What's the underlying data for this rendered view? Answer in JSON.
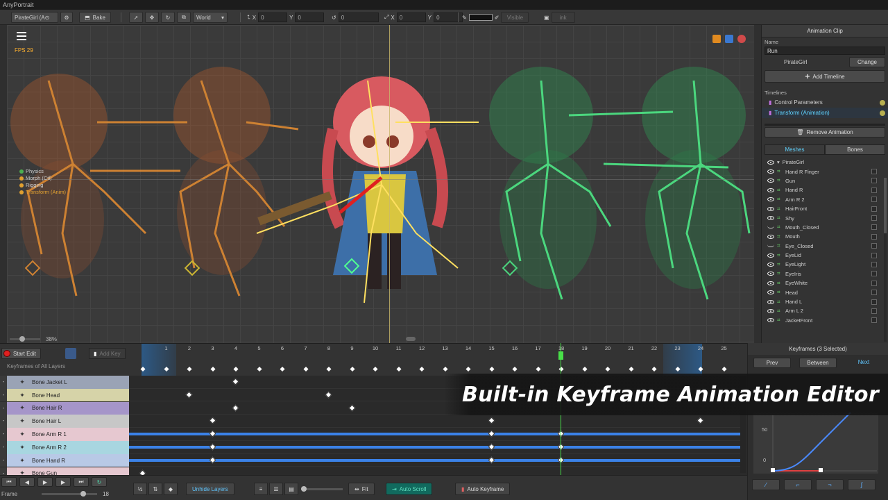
{
  "app": {
    "title": "AnyPortrait"
  },
  "toolbar": {
    "portrait_selector": "PirateGirl (A⊙",
    "bake_label": "Bake",
    "space_select": "World",
    "pos_x_label": "X",
    "pos_x": "0",
    "pos_y_label": "Y",
    "pos_y": "0",
    "rot_value": "0",
    "scale_x_label": "X",
    "scale_x": "0",
    "scale_y_label": "Y",
    "scale_y": "0",
    "visible_label": "Visible",
    "ink_label": "ink"
  },
  "viewport": {
    "fps": "FPS 29",
    "zoom": "38%",
    "timeline_legend": [
      {
        "label": "Physics",
        "color": "#4caf50"
      },
      {
        "label": "Morph (Ctl)",
        "color": "#e0a030"
      },
      {
        "label": "Rigging",
        "color": "#e0a030"
      },
      {
        "label": "Transform (Anim)",
        "color": "#e0a030"
      }
    ],
    "icons": [
      "bone-ik-icon",
      "mesh-icon",
      "physics-icon"
    ]
  },
  "right_panel": {
    "header": "Animation Clip",
    "name_label": "Name",
    "name_value": "Run",
    "target": "PirateGirl",
    "change_label": "Change",
    "add_timeline_label": "Add Timeline",
    "timelines_label": "Timelines",
    "timelines": [
      {
        "label": "Control Parameters",
        "color": "#cfcfcf"
      },
      {
        "label": "Transform (Animation)",
        "color": "#5fd3ff"
      }
    ],
    "remove_animation_label": "Remove Animation",
    "tabs": {
      "meshes": "Meshes",
      "bones": "Bones"
    },
    "tree_root": "PirateGirl",
    "tree_items": [
      {
        "label": "Hand R Finger",
        "eye": "open"
      },
      {
        "label": "Gun",
        "eye": "open"
      },
      {
        "label": "Hand R",
        "eye": "open"
      },
      {
        "label": "Arm R 2",
        "eye": "open"
      },
      {
        "label": "HairFront",
        "eye": "open"
      },
      {
        "label": "Shy",
        "eye": "open"
      },
      {
        "label": "Mouth_Closed",
        "eye": "closed"
      },
      {
        "label": "Mouth",
        "eye": "open"
      },
      {
        "label": "Eye_Closed",
        "eye": "closed"
      },
      {
        "label": "EyeLid",
        "eye": "open"
      },
      {
        "label": "EyeLight",
        "eye": "open"
      },
      {
        "label": "EyeIris",
        "eye": "open"
      },
      {
        "label": "EyeWhite",
        "eye": "open"
      },
      {
        "label": "Head",
        "eye": "open"
      },
      {
        "label": "Hand L",
        "eye": "open"
      },
      {
        "label": "Arm L 2",
        "eye": "open"
      },
      {
        "label": "JacketFront",
        "eye": "open"
      }
    ]
  },
  "timeline": {
    "start_edit_label": "Start Edit",
    "add_key_label": "Add Key",
    "keyframes_all_layers": "Keyframes of All Layers",
    "ruler_ticks": [
      "1",
      "2",
      "3",
      "4",
      "5",
      "6",
      "7",
      "8",
      "9",
      "10",
      "11",
      "12",
      "13",
      "14",
      "15",
      "16",
      "17",
      "18",
      "19",
      "20",
      "21",
      "22",
      "23",
      "24",
      "25"
    ],
    "current_frame": 18,
    "layers": [
      {
        "label": "Bone Jacket L",
        "color": "#9aa3b5"
      },
      {
        "label": "Bone Head",
        "color": "#d6d3a8"
      },
      {
        "label": "Bone Hair R",
        "color": "#a595c9"
      },
      {
        "label": "Bone Hair L",
        "color": "#c7c7c7"
      },
      {
        "label": "Bone Arm R 1",
        "color": "#e6c8d0"
      },
      {
        "label": "Bone Arm R 2",
        "color": "#a8d6e0"
      },
      {
        "label": "Bone Hand R",
        "color": "#b8c9e6"
      },
      {
        "label": "Bone Gun",
        "color": "#e6c8d0"
      }
    ]
  },
  "bottom_bar": {
    "frame_label": "Frame",
    "frame_value": "18",
    "unhide_layers_label": "Unhide Layers",
    "fit_label": "Fit",
    "auto_scroll_label": "Auto Scroll",
    "auto_keyframe_label": "Auto Keyframe"
  },
  "keyframe_panel": {
    "title": "Keyframes (3 Selected)",
    "prev_label": "Prev",
    "between_label": "Between",
    "next_label": "Next",
    "curve_y_top": "50",
    "curve_y_bottom": "0"
  },
  "banner": {
    "text": "Built-in Keyframe Animation Editor"
  }
}
